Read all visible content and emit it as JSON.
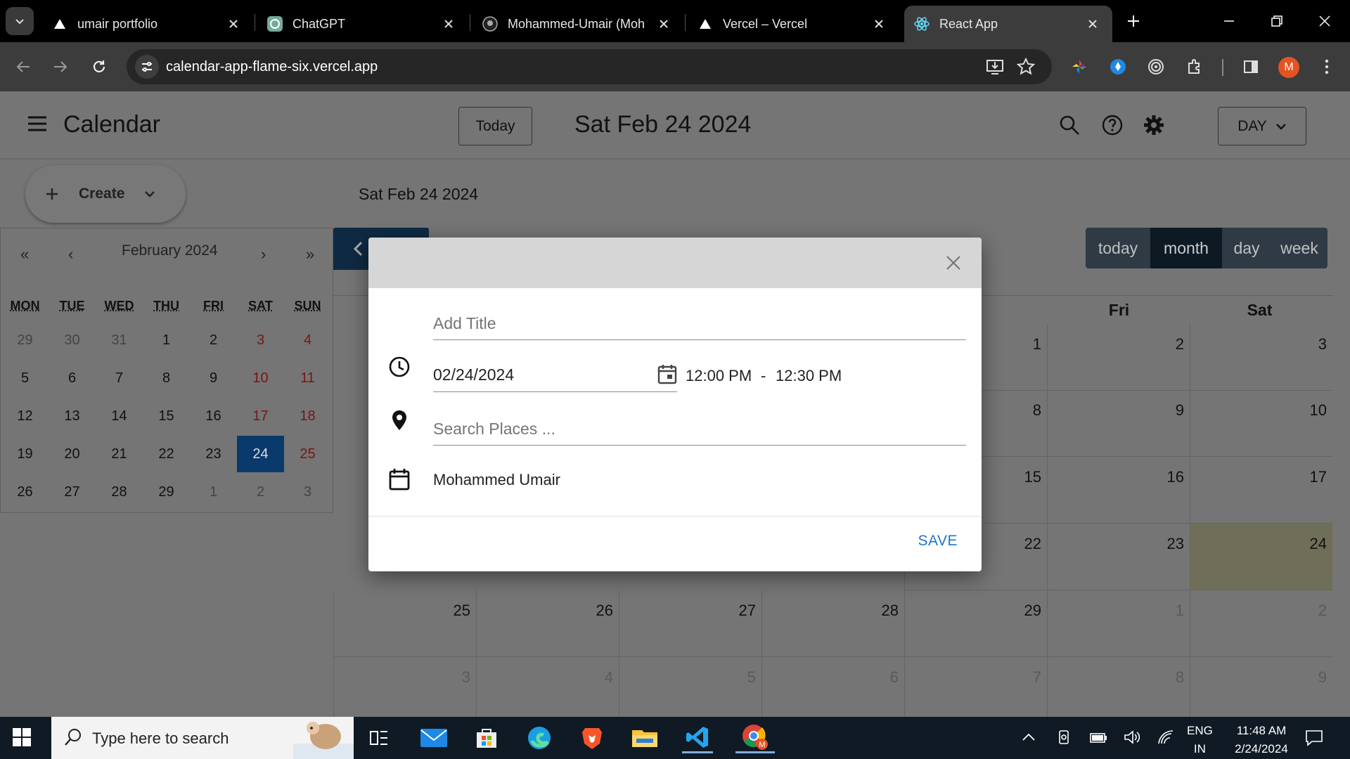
{
  "browser": {
    "tabs": [
      {
        "title": "umair portfolio"
      },
      {
        "title": "ChatGPT"
      },
      {
        "title": "Mohammed-Umair (Moh"
      },
      {
        "title": "Vercel – Vercel"
      },
      {
        "title": "React App",
        "active": true
      }
    ],
    "url": "calendar-app-flame-six.vercel.app",
    "profile_initial": "M"
  },
  "app": {
    "title": "Calendar",
    "today_button": "Today",
    "header_date": "Sat Feb 24 2024",
    "view_select": "DAY",
    "create_label": "Create",
    "sub_date": "Sat Feb 24 2024"
  },
  "mini_calendar": {
    "month_label": "February 2024",
    "nav": {
      "prev_year": "«",
      "prev_month": "‹",
      "next_month": "›",
      "next_year": "»"
    },
    "weekdays": [
      "MON",
      "TUE",
      "WED",
      "THU",
      "FRI",
      "SAT",
      "SUN"
    ],
    "weeks": [
      [
        "29",
        "30",
        "31",
        "1",
        "2",
        "3",
        "4"
      ],
      [
        "5",
        "6",
        "7",
        "8",
        "9",
        "10",
        "11"
      ],
      [
        "12",
        "13",
        "14",
        "15",
        "16",
        "17",
        "18"
      ],
      [
        "19",
        "20",
        "21",
        "22",
        "23",
        "24",
        "25"
      ],
      [
        "26",
        "27",
        "28",
        "29",
        "1",
        "2",
        "3"
      ]
    ],
    "selected": "24"
  },
  "big_calendar": {
    "view_buttons": [
      "today",
      "month",
      "day",
      "week"
    ],
    "active_view": "month",
    "visible_headers": [
      "u",
      "Fri",
      "Sat"
    ],
    "rows": [
      [
        "1",
        "2",
        "3"
      ],
      [
        "8",
        "9",
        "10"
      ],
      [
        "15",
        "16",
        "17"
      ],
      [
        "22",
        "23",
        "24"
      ],
      [
        "25",
        "26",
        "27",
        "28",
        "29",
        "1",
        "2"
      ],
      [
        "3",
        "4",
        "5",
        "6",
        "7",
        "8",
        "9"
      ]
    ]
  },
  "dialog": {
    "title_placeholder": "Add Title",
    "date_value": "02/24/2024",
    "start_time": "12:00 PM",
    "time_separator": "-",
    "end_time": "12:30 PM",
    "place_placeholder": "Search Places ...",
    "calendar_owner": "Mohammed Umair",
    "save_label": "SAVE"
  },
  "taskbar": {
    "search_placeholder": "Type here to search",
    "lang_top": "ENG",
    "lang_bottom": "IN",
    "time": "11:48 AM",
    "date": "2/24/2024"
  },
  "colors": {
    "accent_blue": "#1976d2",
    "selected_day": "#0a3a6b",
    "weekend_red": "#7a1414",
    "profile_orange": "#e55322"
  }
}
